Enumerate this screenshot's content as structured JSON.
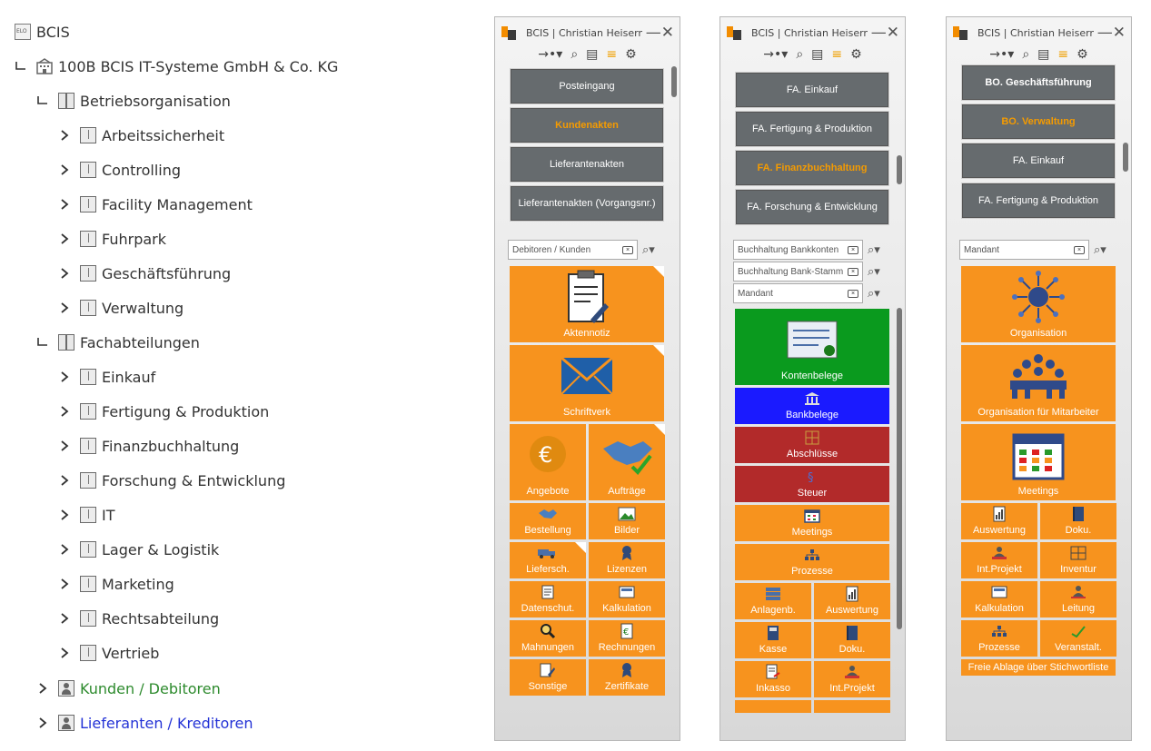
{
  "tree": {
    "root": "BCIS",
    "company": "100B BCIS IT-Systeme GmbH & Co. KG",
    "betriebsorganisation": {
      "label": "Betriebsorganisation",
      "children": [
        "Arbeitssicherheit",
        "Controlling",
        "Facility Management",
        "Fuhrpark",
        "Geschäftsführung",
        "Verwaltung"
      ]
    },
    "fachabteilungen": {
      "label": "Fachabteilungen",
      "children": [
        "Einkauf",
        "Fertigung & Produktion",
        "Finanzbuchhaltung",
        "Forschung & Entwicklung",
        "IT",
        "Lager & Logistik",
        "Marketing",
        "Rechtsabteilung",
        "Vertrieb"
      ]
    },
    "kunden": "Kunden / Debitoren",
    "lieferanten": "Lieferanten / Kreditoren"
  },
  "panel1": {
    "title": "BCIS | Christian Heisermann",
    "buttons": [
      "Posteingang",
      "Kundenakten",
      "Lieferantenakten",
      "Lieferantenakten (Vorgangsnr.)"
    ],
    "search": "Debitoren / Kunden",
    "tiles": {
      "aktennotiz": "Aktennotiz",
      "schriftverk": "Schriftverk",
      "angebote": "Angebote",
      "auftraege": "Aufträge",
      "bestellung": "Bestellung",
      "bilder": "Bilder",
      "lieferschein": "Liefersch.",
      "lizenzen": "Lizenzen",
      "datenschutz": "Datenschut.",
      "kalkulation": "Kalkulation",
      "mahnungen": "Mahnungen",
      "rechnungen": "Rechnungen",
      "sonstige": "Sonstige",
      "zertifikate": "Zertifikate"
    }
  },
  "panel2": {
    "title": "BCIS | Christian Heisermann",
    "buttons": [
      "FA. Einkauf",
      "FA. Fertigung & Produktion",
      "FA. Finanzbuchhaltung",
      "FA. Forschung & Entwicklung"
    ],
    "searches": [
      "Buchhaltung Bankkonten",
      "Buchhaltung Bank-Stamm",
      "Mandant"
    ],
    "tiles": {
      "kontenbelege": "Kontenbelege",
      "bankbelege": "Bankbelege",
      "abschluesse": "Abschlüsse",
      "steuer": "Steuer",
      "meetings": "Meetings",
      "prozesse": "Prozesse",
      "anlagenb": "Anlagenb.",
      "auswertung": "Auswertung",
      "kasse": "Kasse",
      "doku": "Doku.",
      "inkasso": "Inkasso",
      "intprojekt": "Int.Projekt"
    }
  },
  "panel3": {
    "title": "BCIS | Christian Heisermann",
    "buttons": [
      "BO. Geschäftsführung",
      "BO. Verwaltung",
      "FA. Einkauf",
      "FA. Fertigung & Produktion"
    ],
    "search": "Mandant",
    "tiles": {
      "organisation": "Organisation",
      "orgmitarbeiter": "Organisation für Mitarbeiter",
      "meetings": "Meetings",
      "auswertung": "Auswertung",
      "doku": "Doku.",
      "intprojekt": "Int.Projekt",
      "inventur": "Inventur",
      "kalkulation": "Kalkulation",
      "leitung": "Leitung",
      "prozesse": "Prozesse",
      "veranstalt": "Veranstalt.",
      "freie": "Freie Ablage über Stichwortliste"
    }
  },
  "colors": {
    "tile_orange": "#f7931e",
    "button_grey": "#666b6e",
    "active_orange": "#f59b00",
    "green_tile": "#0a9a1e",
    "blue_tile": "#1a1aff",
    "red_tile": "#b22a2a"
  }
}
